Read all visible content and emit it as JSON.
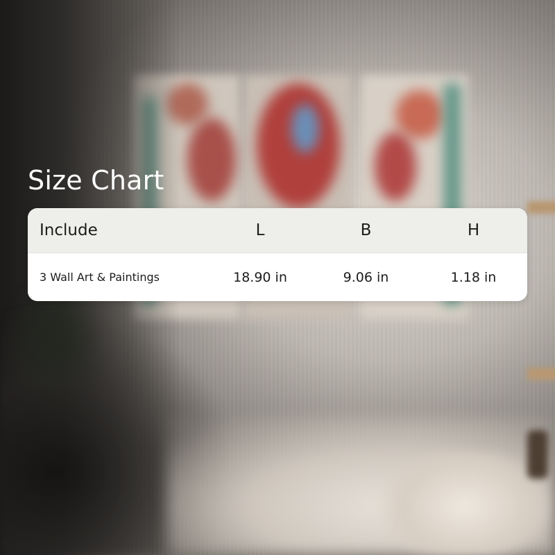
{
  "title": "Size Chart",
  "table": {
    "headers": [
      "Include",
      "L",
      "B",
      "H"
    ],
    "rows": [
      {
        "include": "3 Wall Art & Paintings",
        "l": "18.90 in",
        "b": "9.06 in",
        "h": "1.18 in"
      }
    ]
  },
  "colors": {
    "title_text": "#ffffff",
    "header_bg": "#eeeeea",
    "card_bg": "#ffffff",
    "text": "#1c1c1c"
  }
}
